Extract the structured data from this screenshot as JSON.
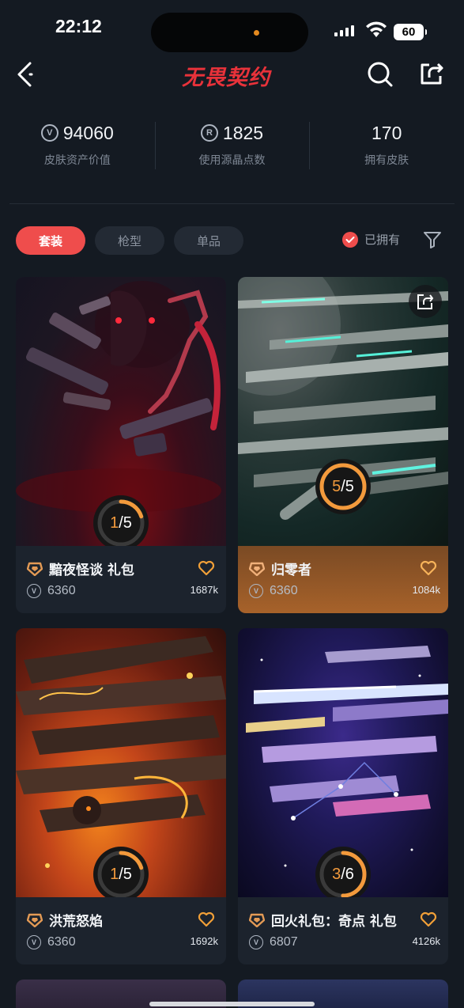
{
  "status": {
    "time": "22:12",
    "battery": "60"
  },
  "header": {
    "logo": "无畏契约"
  },
  "stats": [
    {
      "icon": "valorant-points-icon",
      "value": "94060",
      "label": "皮肤资产价值"
    },
    {
      "icon": "radianite-icon",
      "value": "1825",
      "label": "使用源晶点数"
    },
    {
      "value": "170",
      "label": "拥有皮肤"
    }
  ],
  "tabs": [
    {
      "label": "套装",
      "active": true
    },
    {
      "label": "枪型",
      "active": false
    },
    {
      "label": "单品",
      "active": false
    }
  ],
  "filter": {
    "owned_label": "已拥有"
  },
  "cards": [
    {
      "title": "黯夜怪谈 礼包",
      "price": "6360",
      "likes": "1687k",
      "progress_owned": "1",
      "progress_total": "/5",
      "progress_fraction": 0.2,
      "theme": "dark-red",
      "highlight": false
    },
    {
      "title": "归零者",
      "price": "6360",
      "likes": "1084k",
      "progress_owned": "5",
      "progress_total": "/5",
      "progress_fraction": 1.0,
      "theme": "teal",
      "highlight": true
    },
    {
      "title": "洪荒怒焰",
      "price": "6360",
      "likes": "1692k",
      "progress_owned": "1",
      "progress_total": "/5",
      "progress_fraction": 0.2,
      "theme": "fire",
      "highlight": false
    },
    {
      "title": "回火礼包：奇点 礼包",
      "price": "6807",
      "likes": "4126k",
      "progress_owned": "3",
      "progress_total": "/6",
      "progress_fraction": 0.5,
      "theme": "galaxy",
      "highlight": false
    }
  ],
  "colors": {
    "accent": "#ef4d4c",
    "progress": "#f39a3c",
    "background": "#141a22",
    "logo": "#e8323a"
  }
}
